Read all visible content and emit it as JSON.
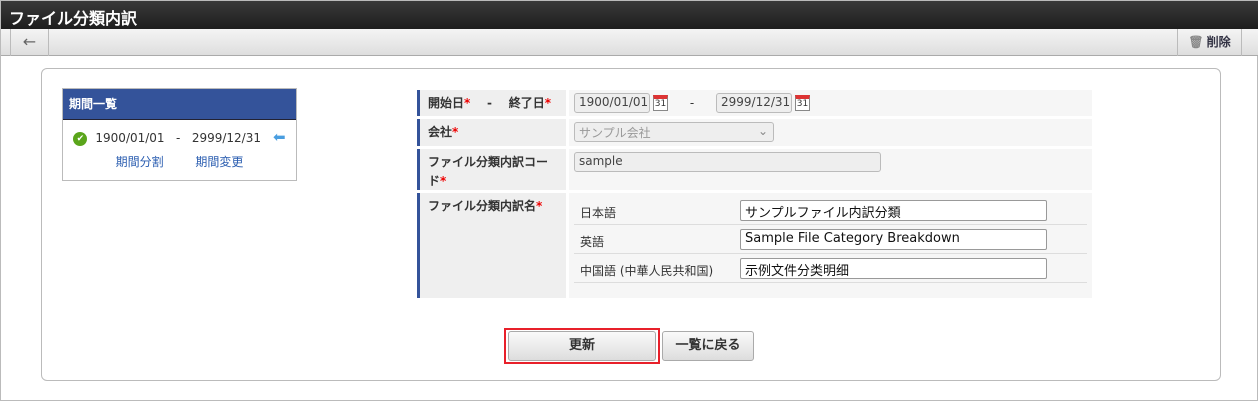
{
  "header": {
    "title": "ファイル分類内訳"
  },
  "toolbar": {
    "back_icon": "←",
    "delete_label": "削除"
  },
  "period_list": {
    "title": "期間一覧",
    "start": "1900/01/01",
    "sep": "-",
    "end": "2999/12/31",
    "split_link": "期間分割",
    "change_link": "期間変更"
  },
  "form": {
    "date_label_start": "開始日",
    "date_sep": "-",
    "date_label_end": "終了日",
    "start_date": "1900/01/01",
    "end_date": "2999/12/31",
    "cal_text": "31",
    "company_label": "会社",
    "company_value": "サンプル会社",
    "code_label": "ファイル分類内訳コード",
    "code_value": "sample",
    "name_label": "ファイル分類内訳名",
    "names": [
      {
        "lang": "日本語",
        "value": "サンプルファイル内訳分類"
      },
      {
        "lang": "英語",
        "value": "Sample File Category Breakdown"
      },
      {
        "lang": "中国語 (中華人民共和国)",
        "value": "示例文件分类明细"
      }
    ],
    "required_mark": "*"
  },
  "buttons": {
    "update": "更新",
    "back_to_list": "一覧に戻る"
  },
  "colors": {
    "accent": "#34539a",
    "highlight": "#e8202a"
  }
}
